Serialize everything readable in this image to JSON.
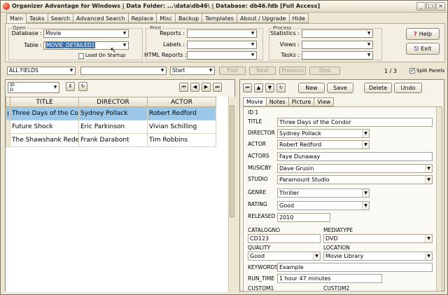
{
  "window": {
    "title": "Organizer Advantage for Windows | Data Folder: ...\\data\\db46\\ | Database: db46.fdb [Full Access]",
    "minimize": "_",
    "maximize": "□",
    "close": "×"
  },
  "menu_tabs": [
    "Main",
    "Tasks",
    "Search",
    "Advanced Search",
    "Replace",
    "Misc",
    "Backup",
    "Templates",
    "About / Upgrade",
    "Hide"
  ],
  "open": {
    "group_title": "Open :",
    "database_label": "Database :",
    "database_value": "Movie",
    "table_label": "Table :",
    "table_value": "MOVIE_DETAILED1",
    "load_on_startup_label": "Load On Startup"
  },
  "print": {
    "group_title": "Print :",
    "reports_label": "Reports :",
    "labels_label": "Labels :",
    "html_reports_label": "HTML Reports :"
  },
  "process": {
    "group_title": "Process :",
    "statistics_label": "Statistics :",
    "views_label": "Views :",
    "tasks_label": "Tasks :"
  },
  "buttons": {
    "help": "Help",
    "exit": "Exit"
  },
  "search": {
    "field_value": "ALL FIELDS",
    "mode_value": "Start",
    "find": "Find",
    "next": "Next",
    "previous": "Previous",
    "stop": "Stop",
    "record_counter": "1 / 3",
    "split_panels_label": "Split Panels"
  },
  "sort": {
    "field_line1": "ID",
    "field_line2": "D"
  },
  "grid": {
    "columns": [
      "TITLE",
      "DIRECTOR",
      "ACTOR"
    ],
    "current_row_marker": "I",
    "rows": [
      [
        "Three Days of the Condor",
        "Sydney Pollack",
        "Robert Redford"
      ],
      [
        "Future Shock",
        "Eric Parkinson",
        "Vivian Schilling"
      ],
      [
        "The Shawshank Redemption",
        "Frank Darabont",
        "Tim Robbins"
      ]
    ]
  },
  "record_buttons": {
    "new": "New",
    "save": "Save",
    "delete": "Delete",
    "undo": "Undo"
  },
  "detail_tabs": [
    "Movie",
    "Notes",
    "Picture",
    "View"
  ],
  "form": {
    "id_label": "ID 1",
    "title_label": "TITLE",
    "title_value": "Three Days of the Condor",
    "director_label": "DIRECTOR",
    "director_value": "Sydney Pollack",
    "actor_label": "ACTOR",
    "actor_value": "Robert Redford",
    "actors_label": "ACTORS",
    "actors_value": "Faye Dunaway",
    "musicby_label": "MUSICBY",
    "musicby_value": "Dave Grusin",
    "studio_label": "STUDIO",
    "studio_value": "Paramount Studio",
    "genre_label": "GENRE",
    "genre_value": "Thriller",
    "rating_label": "RATING",
    "rating_value": "Good",
    "released_label": "RELEASED",
    "released_value": "2010",
    "catalogno_label": "CATALOGNO",
    "catalogno_value": "CD123",
    "mediatype_label": "MEDIATYPE",
    "mediatype_value": "DVD",
    "quality_label": "QUALITY",
    "quality_value": "Good",
    "location_label": "LOCATION",
    "location_value": "Movie Library",
    "keywords_label": "KEYWORDS",
    "keywords_value": "Example",
    "runtime_label": "RUN_TIME",
    "runtime_value": "1 hour 47 minutes",
    "custom1_label": "CUSTOM1",
    "custom2_label": "CUSTOM2"
  },
  "colors": {
    "selection": "#3a6ea8",
    "row_highlight": "#9bc8e8",
    "window_bg": "#ece6d2"
  }
}
